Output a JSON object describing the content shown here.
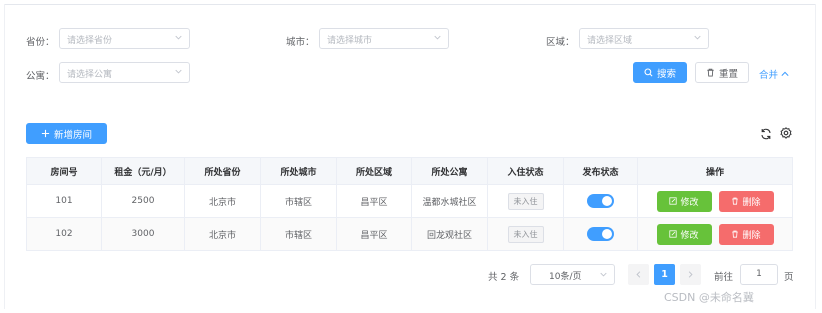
{
  "filters": {
    "province": {
      "label": "省份：",
      "placeholder": "请选择省份"
    },
    "city": {
      "label": "城市：",
      "placeholder": "请选择城市"
    },
    "district": {
      "label": "区域：",
      "placeholder": "请选择区域"
    },
    "apartment": {
      "label": "公寓：",
      "placeholder": "请选择公寓"
    },
    "search_label": "搜索",
    "reset_label": "重置",
    "collapse_label": "合并"
  },
  "toolbar": {
    "add_label": "新增房间",
    "icons": [
      "refresh-icon",
      "settings-icon"
    ]
  },
  "table": {
    "headers": [
      "房间号",
      "租金（元/月）",
      "所处省份",
      "所处城市",
      "所处区域",
      "所处公寓",
      "入住状态",
      "发布状态",
      "操作"
    ],
    "rows": [
      {
        "room_no": "101",
        "rent": "2500",
        "province": "北京市",
        "city": "市辖区",
        "district": "昌平区",
        "apartment": "温都水城社区",
        "checkin_status": "未入住",
        "published": true
      },
      {
        "room_no": "102",
        "rent": "3000",
        "province": "北京市",
        "city": "市辖区",
        "district": "昌平区",
        "apartment": "回龙观社区",
        "checkin_status": "未入住",
        "published": true
      }
    ],
    "edit_label": "修改",
    "delete_label": "删除"
  },
  "pagination": {
    "total_text": "共 2 条",
    "page_size": "10条/页",
    "current_page": "1",
    "goto_prefix": "前往",
    "goto_value": "1",
    "goto_suffix": "页"
  },
  "watermark": "CSDN @未命名冀",
  "colors": {
    "primary": "#409eff",
    "success": "#67c23a",
    "danger": "#f56c6c",
    "header_bg": "#f5f7fa"
  }
}
